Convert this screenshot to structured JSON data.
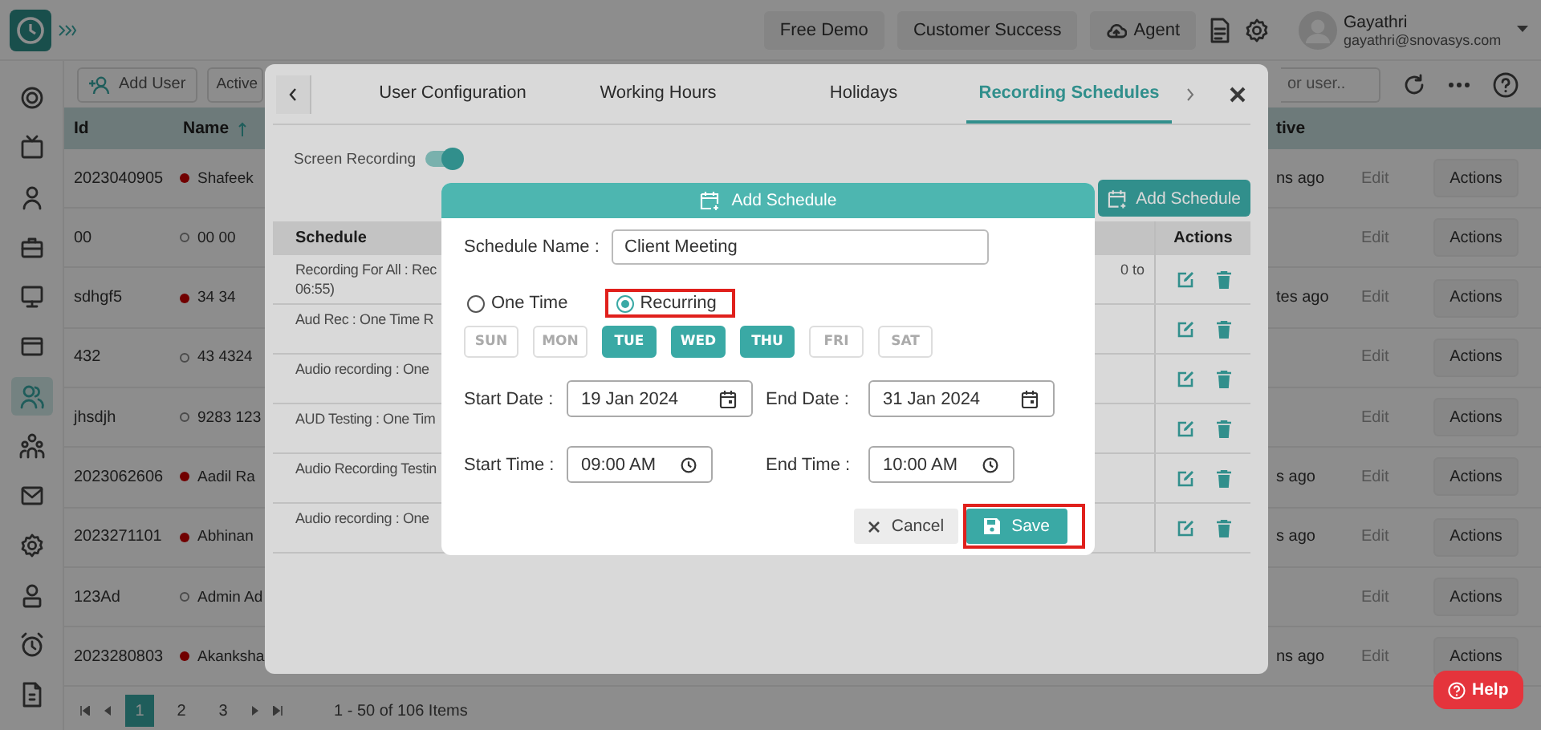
{
  "top_bar": {
    "buttons": [
      {
        "label": "Free Demo",
        "kind": "plain"
      },
      {
        "label": "Customer Success",
        "kind": "plain"
      },
      {
        "label": "Agent",
        "kind": "cloud"
      }
    ],
    "user": {
      "name": "Gayathri",
      "email": "gayathri@snovasys.com"
    }
  },
  "sidebar": {
    "items": [
      {
        "kind": "target",
        "selected": false
      },
      {
        "kind": "tv",
        "selected": false
      },
      {
        "kind": "user",
        "selected": false
      },
      {
        "kind": "briefcase",
        "selected": false
      },
      {
        "kind": "monitor",
        "selected": false
      },
      {
        "kind": "card",
        "selected": false
      },
      {
        "kind": "users",
        "selected": true
      },
      {
        "kind": "team",
        "selected": false
      },
      {
        "kind": "mail",
        "selected": false
      },
      {
        "kind": "gear",
        "selected": false
      },
      {
        "kind": "badge",
        "selected": false
      },
      {
        "kind": "alarm",
        "selected": false
      },
      {
        "kind": "invoice",
        "selected": false
      }
    ]
  },
  "toolbar": {
    "add_user": "Add User",
    "filter": "Active",
    "search_placeholder": "or user.."
  },
  "table": {
    "columns": [
      {
        "label": "Id",
        "sorted": false
      },
      {
        "label": "Name",
        "sorted": true
      },
      {
        "label": "tive",
        "sorted": false
      }
    ],
    "rows": [
      {
        "id": "2023040905",
        "name": "Shafeek",
        "online": true,
        "last_active": "ns ago",
        "edit": "Edit",
        "action": "Actions"
      },
      {
        "id": "00",
        "name": "00 00",
        "online": false,
        "last_active": "",
        "edit": "Edit",
        "action": "Actions"
      },
      {
        "id": "sdhgf5",
        "name": "34 34",
        "online": true,
        "last_active": "tes ago",
        "edit": "Edit",
        "action": "Actions"
      },
      {
        "id": "432",
        "name": "43 4324",
        "online": false,
        "last_active": "",
        "edit": "Edit",
        "action": "Actions"
      },
      {
        "id": "jhsdjh",
        "name": "9283 123",
        "online": false,
        "last_active": "",
        "edit": "Edit",
        "action": "Actions"
      },
      {
        "id": "2023062606",
        "name": "Aadil Ra",
        "online": true,
        "last_active": "s ago",
        "edit": "Edit",
        "action": "Actions"
      },
      {
        "id": "2023271101",
        "name": "Abhinan",
        "online": true,
        "last_active": "s ago",
        "edit": "Edit",
        "action": "Actions"
      },
      {
        "id": "123Ad",
        "name": "Admin Ad",
        "online": false,
        "last_active": "",
        "edit": "Edit",
        "action": "Actions"
      },
      {
        "id": "2023280803",
        "name": "Akanksha",
        "online": true,
        "last_active": "ns ago",
        "edit": "Edit",
        "action": "Actions"
      }
    ]
  },
  "pagination": {
    "pages": [
      {
        "label": "1",
        "selected": true
      },
      {
        "label": "2",
        "selected": false
      },
      {
        "label": "3",
        "selected": false
      }
    ],
    "summary": "1 - 50 of 106 Items"
  },
  "help_button": "Help",
  "config_dialog": {
    "tabs": [
      {
        "label": "User Configuration",
        "selected": false
      },
      {
        "label": "Working Hours",
        "selected": false
      },
      {
        "label": "Holidays",
        "selected": false
      },
      {
        "label": "Recording Schedules",
        "selected": true
      }
    ],
    "screen_recording": {
      "label": "Screen Recording",
      "on": true
    },
    "add_button": "Add Schedule",
    "schedule_table": {
      "columns": [
        "Schedule",
        "Actions"
      ],
      "rows": [
        {
          "text": "Recording For All : Rec",
          "text_2": "06:55)",
          "tail": "0 to"
        },
        {
          "text": "Aud Rec : One Time R"
        },
        {
          "text": "Audio recording : One"
        },
        {
          "text": "AUD Testing : One Tim"
        },
        {
          "text": "Audio Recording Testin"
        },
        {
          "text": "Audio recording : One"
        }
      ]
    }
  },
  "schedule_dialog": {
    "title": "Add Schedule",
    "name_label": "Schedule Name :",
    "name_value": "Client Meeting",
    "types": [
      {
        "label": "One Time",
        "selected": false,
        "highlighted": false
      },
      {
        "label": "Recurring",
        "selected": true,
        "highlighted": true
      }
    ],
    "days": [
      {
        "label": "SUN",
        "selected": false
      },
      {
        "label": "MON",
        "selected": false
      },
      {
        "label": "TUE",
        "selected": true
      },
      {
        "label": "WED",
        "selected": true
      },
      {
        "label": "THU",
        "selected": true
      },
      {
        "label": "FRI",
        "selected": false
      },
      {
        "label": "SAT",
        "selected": false
      }
    ],
    "dates": [
      {
        "label": "Start Date :",
        "value": "19 Jan 2024",
        "kind": "date"
      },
      {
        "label": "End Date :",
        "value": "31 Jan 2024",
        "kind": "date"
      }
    ],
    "times": [
      {
        "label": "Start Time :",
        "value": "09:00 AM",
        "kind": "time"
      },
      {
        "label": "End Time :",
        "value": "10:00 AM",
        "kind": "time"
      }
    ],
    "cancel": {
      "label": "Cancel"
    },
    "save": {
      "label": "Save",
      "highlighted": true
    }
  }
}
